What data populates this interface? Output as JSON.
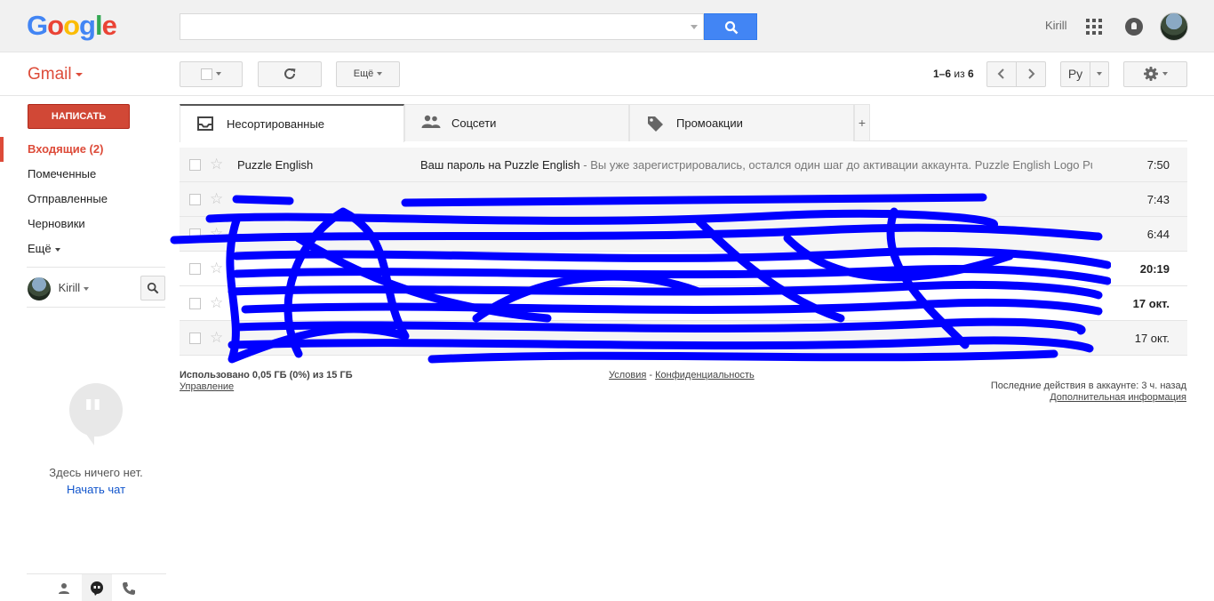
{
  "header": {
    "logo_letters": [
      {
        "ch": "G",
        "color": "#4285f4"
      },
      {
        "ch": "o",
        "color": "#ea4335"
      },
      {
        "ch": "o",
        "color": "#fbbc05"
      },
      {
        "ch": "g",
        "color": "#4285f4"
      },
      {
        "ch": "l",
        "color": "#34a853"
      },
      {
        "ch": "e",
        "color": "#ea4335"
      }
    ],
    "search_value": "",
    "search_placeholder": "",
    "user_name": "Kirill",
    "icons": [
      "search-icon",
      "apps-grid-icon",
      "notifications-bell-icon",
      "account-avatar"
    ]
  },
  "toolbar": {
    "app_label": "Gmail",
    "more_label": "Ещё",
    "pager_range": "1–6",
    "pager_of": "из",
    "pager_total": "6",
    "input_tools_label": "Ру"
  },
  "sidebar": {
    "compose_label": "НАПИСАТЬ",
    "items": [
      {
        "label": "Входящие (2)",
        "active": true
      },
      {
        "label": "Помеченные",
        "active": false
      },
      {
        "label": "Отправленные",
        "active": false
      },
      {
        "label": "Черновики",
        "active": false
      },
      {
        "label": "Ещё",
        "active": false
      }
    ],
    "chat_user": "Kirill",
    "empty_chat_text": "Здесь ничего нет.",
    "start_chat_link": "Начать чат"
  },
  "tabs": [
    {
      "label": "Несортированные",
      "active": true,
      "icon": "inbox-icon"
    },
    {
      "label": "Соцсети",
      "active": false,
      "icon": "people-icon"
    },
    {
      "label": "Промоакции",
      "active": false,
      "icon": "tag-icon"
    }
  ],
  "messages": [
    {
      "sender": "Puzzle English",
      "subject": "Ваш пароль на Puzzle English",
      "snippet": " - Вы уже зарегистрировались, остался один шаг до активации аккаунта. Puzzle English Logo Puzzle",
      "date": "7:50",
      "unread": false
    },
    {
      "sender": "",
      "subject": "",
      "snippet": "",
      "date": "7:43",
      "unread": false
    },
    {
      "sender": "",
      "subject": "",
      "snippet": "",
      "date": "6:44",
      "unread": false
    },
    {
      "sender": "",
      "subject": "",
      "snippet": "",
      "date": "20:19",
      "unread": true
    },
    {
      "sender": "",
      "subject": "",
      "snippet": "",
      "date": "17 окт.",
      "unread": true
    },
    {
      "sender": "",
      "subject": "",
      "snippet": "",
      "date": "17 окт.",
      "unread": false
    }
  ],
  "footer": {
    "storage_text": "Использовано 0,05 ГБ (0%) из 15 ГБ",
    "manage_link": "Управление",
    "terms_link": "Условия",
    "separator": " - ",
    "privacy_link": "Конфиденциальность",
    "last_activity": "Последние действия в аккаунте: 3 ч. назад",
    "details_link": "Дополнительная информация"
  },
  "colors": {
    "accent_red": "#dd4b39",
    "compose_red": "#d14836",
    "search_blue": "#4285f4",
    "link_blue": "#1155cc",
    "redaction_blue": "#0000ff"
  }
}
